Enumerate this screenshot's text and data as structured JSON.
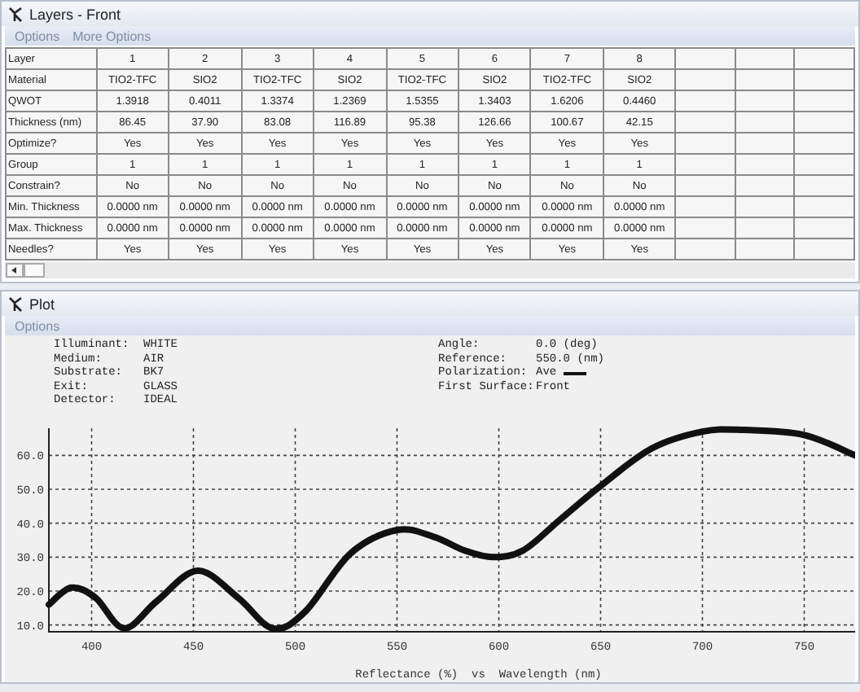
{
  "layers_window": {
    "title": "Layers - Front",
    "menu": [
      "Options",
      "More Options"
    ],
    "table": {
      "columns": [
        "Layer",
        "1",
        "2",
        "3",
        "4",
        "5",
        "6",
        "7",
        "8"
      ],
      "rows": [
        [
          "Material",
          "TIO2-TFC",
          "SIO2",
          "TIO2-TFC",
          "SIO2",
          "TIO2-TFC",
          "SIO2",
          "TIO2-TFC",
          "SIO2"
        ],
        [
          "QWOT",
          "1.3918",
          "0.4011",
          "1.3374",
          "1.2369",
          "1.5355",
          "1.3403",
          "1.6206",
          "0.4460"
        ],
        [
          "Thickness (nm)",
          "86.45",
          "37.90",
          "83.08",
          "116.89",
          "95.38",
          "126.66",
          "100.67",
          "42.15"
        ],
        [
          "Optimize?",
          "Yes",
          "Yes",
          "Yes",
          "Yes",
          "Yes",
          "Yes",
          "Yes",
          "Yes"
        ],
        [
          "Group",
          "1",
          "1",
          "1",
          "1",
          "1",
          "1",
          "1",
          "1"
        ],
        [
          "Constrain?",
          "No",
          "No",
          "No",
          "No",
          "No",
          "No",
          "No",
          "No"
        ],
        [
          "Min. Thickness",
          "0.0000 nm",
          "0.0000 nm",
          "0.0000 nm",
          "0.0000 nm",
          "0.0000 nm",
          "0.0000 nm",
          "0.0000 nm",
          "0.0000 nm"
        ],
        [
          "Max. Thickness",
          "0.0000 nm",
          "0.0000 nm",
          "0.0000 nm",
          "0.0000 nm",
          "0.0000 nm",
          "0.0000 nm",
          "0.0000 nm",
          "0.0000 nm"
        ],
        [
          "Needles?",
          "Yes",
          "Yes",
          "Yes",
          "Yes",
          "Yes",
          "Yes",
          "Yes",
          "Yes"
        ]
      ]
    }
  },
  "plot_window": {
    "title": "Plot",
    "menu": [
      "Options"
    ],
    "info_left": [
      {
        "label": "Illuminant:",
        "value": "WHITE",
        "kind": "text"
      },
      {
        "label": "Medium:",
        "value": "AIR",
        "kind": "text"
      },
      {
        "label": "Substrate:",
        "value": "BK7",
        "kind": "text"
      },
      {
        "label": "Exit:",
        "value": "GLASS",
        "kind": "text"
      },
      {
        "label": "Detector:",
        "value": "IDEAL",
        "kind": "text"
      }
    ],
    "info_right": [
      {
        "label": "Angle:",
        "value": "0.0 (deg)",
        "kind": "text"
      },
      {
        "label": "Reference:",
        "value": "550.0 (nm)",
        "kind": "text"
      },
      {
        "label": "Polarization:",
        "kind": "legend"
      },
      {
        "label": "First Surface:",
        "value": "Front",
        "kind": "text"
      }
    ],
    "chart_data": {
      "type": "line",
      "grid": true,
      "xlabel": "Reflectance (%)  vs  Wavelength (nm)",
      "xlim": [
        379,
        775
      ],
      "ylim": [
        8,
        68
      ],
      "xticks": [
        400,
        450,
        500,
        550,
        600,
        650,
        700,
        750
      ],
      "yticks": [
        {
          "value": 10,
          "label": "10.0"
        },
        {
          "value": 20,
          "label": "20.0"
        },
        {
          "value": 30,
          "label": "30.0"
        },
        {
          "value": 40,
          "label": "40.0"
        },
        {
          "value": 50,
          "label": "50.0"
        },
        {
          "value": 60,
          "label": "60.0"
        }
      ],
      "x": [
        379,
        390,
        402,
        416,
        432,
        452,
        472,
        489,
        505,
        527,
        550,
        568,
        583,
        597,
        612,
        630,
        650,
        675,
        700,
        720,
        750,
        775
      ],
      "series": [
        {
          "name": "Ave",
          "color": "#111111",
          "values": [
            16,
            21,
            18,
            9,
            17,
            26,
            18,
            9,
            14,
            31,
            38,
            36,
            32,
            30,
            32,
            41,
            51,
            62,
            67,
            67.5,
            66,
            60
          ]
        }
      ]
    }
  }
}
